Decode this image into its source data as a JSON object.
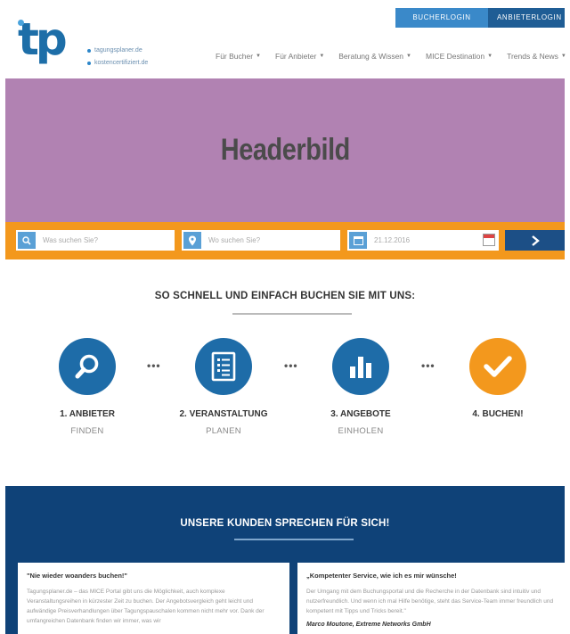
{
  "header": {
    "login_buttons": [
      "BUCHERLOGIN",
      "ANBIETERLOGIN"
    ],
    "logo_text": "tp",
    "domains": [
      "tagungsplaner.de",
      "kostencertifiziert.de"
    ],
    "nav": [
      "Für Bucher",
      "Für Anbieter",
      "Beratung & Wissen",
      "MICE Destination",
      "Trends & News"
    ]
  },
  "hero": {
    "title": "Headerbild"
  },
  "search": {
    "what_placeholder": "Was suchen Sie?",
    "where_placeholder": "Wo suchen Sie?",
    "date_value": "21.12.2016"
  },
  "steps": {
    "title": "SO SCHNELL UND EINFACH BUCHEN SIE MIT UNS:",
    "items": [
      {
        "label": "1. ANBIETER",
        "sub": "FINDEN",
        "icon": "search-icon",
        "color": "#1e6ca8"
      },
      {
        "label": "2. VERANSTALTUNG",
        "sub": "PLANEN",
        "icon": "checklist-icon",
        "color": "#1e6ca8"
      },
      {
        "label": "3. ANGEBOTE",
        "sub": "EINHOLEN",
        "icon": "bar-chart-icon",
        "color": "#1e6ca8"
      },
      {
        "label": "4. BUCHEN!",
        "sub": "",
        "icon": "checkmark-icon",
        "color": "#f3981d"
      }
    ],
    "dots": "•••"
  },
  "testimonials": {
    "title": "UNSERE KUNDEN SPRECHEN FÜR SICH!",
    "cards": [
      {
        "title": "\"Nie wieder woanders buchen!\"",
        "body": "Tagungsplaner.de – das MICE Portal gibt uns die Möglichkeit, auch komplexe Veranstaltungsreihen in kürzester Zeit zu buchen. Der Angebotsvergleich geht leicht und aufwändige Preisverhandlungen über Tagungspauschalen kommen nicht mehr vor. Dank der umfangreichen Datenbank finden wir immer, was wir",
        "author": ""
      },
      {
        "title": "„Kompetenter Service, wie ich es mir wünsche!",
        "body": "Der Umgang mit dem Buchungsportal und die Recherche in der Datenbank sind intuitiv und nutzerfreundlich. Und wenn ich mal Hilfe benötige, steht das Service-Team immer freundlich und kompetent mit Tipps und Tricks bereit.\"",
        "author": "Marco Moutone, Extreme Networks GmbH"
      }
    ]
  },
  "colors": {
    "blue": "#1e6ca8",
    "orange": "#f3981d",
    "navy": "#0f4278",
    "hero": "#b182b2"
  }
}
